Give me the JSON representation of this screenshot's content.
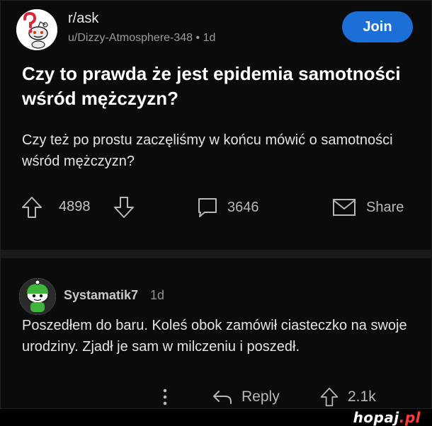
{
  "post": {
    "subreddit": "r/ask",
    "author": "u/Dizzy-Atmosphere-348",
    "age": "1d",
    "join_label": "Join",
    "title": "Czy to prawda że jest epidemia samotności wśród mężczyzn?",
    "body": "Czy też po prostu zaczęliśmy w końcu mówić o samotności wśród mężczyzn?",
    "votes": "4898",
    "comments": "3646",
    "share_label": "Share"
  },
  "comment": {
    "username": "Systamatik7",
    "age": "1d",
    "text": "Poszedłem do baru. Koleś obok zamówił ciasteczko na swoje urodziny. Zjadł je sam w milczeniu i poszedł.",
    "reply_label": "Reply",
    "votes": "2.1k"
  },
  "watermark": {
    "name": "hopaj",
    "tld": ".pl"
  },
  "colors": {
    "background": "#0b0b0b",
    "join_button": "#1d6fd8",
    "text": "#e4e4e4",
    "muted": "#9a9a9a"
  }
}
